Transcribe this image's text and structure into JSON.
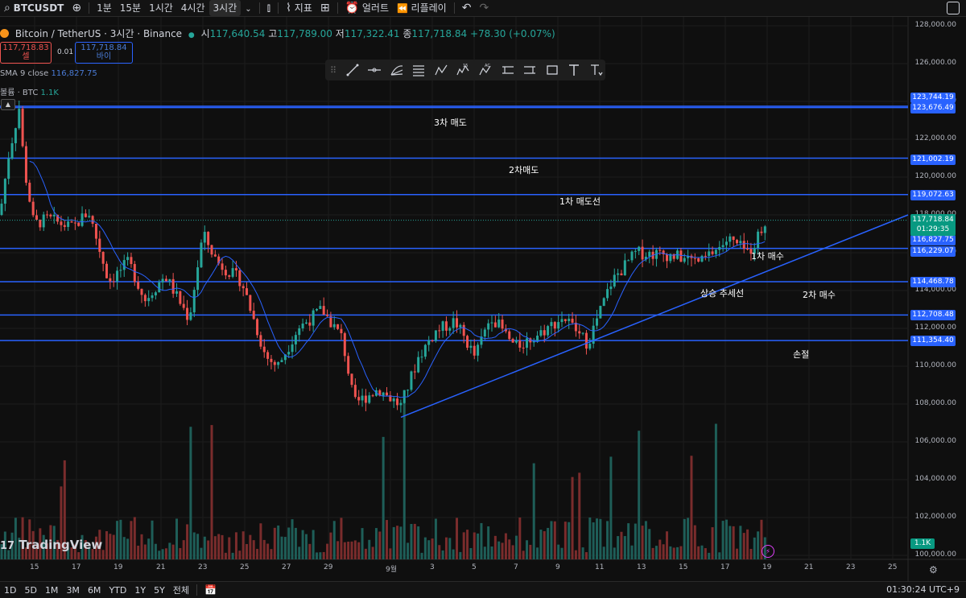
{
  "topbar": {
    "symbol": "BTCUSDT",
    "intervals": [
      "1분",
      "15분",
      "1시간",
      "4시간",
      "3시간"
    ],
    "active_interval": "3시간",
    "indicators_label": "지표",
    "alert_label": "얼러트",
    "replay_label": "리플레이"
  },
  "legend": {
    "title": "Bitcoin / TetherUS · 3시간 · Binance",
    "open_label": "시",
    "open": "117,640.54",
    "high_label": "고",
    "high": "117,789.00",
    "low_label": "저",
    "low": "117,322.41",
    "close_label": "종",
    "close": "117,718.84",
    "change": "+78.30 (+0.07%)",
    "sell_price": "117,718.83",
    "sell_label": "셀",
    "spread": "0.01",
    "buy_price": "117,718.84",
    "buy_label": "바이",
    "sma_label": "SMA 9 close",
    "sma_value": "116,827.75",
    "volume_label": "볼륨 · BTC",
    "volume_value": "1.1K"
  },
  "price_axis": {
    "ticks": [
      "128,000.00",
      "126,000.00",
      "124,000.00",
      "122,000.00",
      "120,000.00",
      "118,000.00",
      "116,000.00",
      "114,000.00",
      "112,000.00",
      "110,000.00",
      "108,000.00",
      "106,000.00",
      "104,000.00",
      "102,000.00",
      "100,000.00"
    ],
    "level_tags": [
      "123,744.19",
      "123,676.49",
      "121,002.19",
      "119,072.63",
      "116,827.75",
      "116,229.07",
      "114,468.78",
      "112,708.48",
      "111,354.40"
    ],
    "current_price": "117,718.84",
    "countdown": "01:29:35",
    "volume_tag": "1.1K"
  },
  "time_axis": {
    "labels": [
      "15",
      "17",
      "19",
      "21",
      "23",
      "25",
      "27",
      "29",
      "9월",
      "3",
      "5",
      "7",
      "9",
      "11",
      "13",
      "15",
      "17",
      "19",
      "21",
      "23",
      "25"
    ]
  },
  "annotations": {
    "sell3": "3차 매도",
    "sell2": "2차매도",
    "sell1": "1차 매도선",
    "buy1": "1차 매수",
    "trendline": "상승 추세선",
    "buy2": "2차 매수",
    "stop": "손절"
  },
  "bottombar": {
    "ranges": [
      "1D",
      "5D",
      "1M",
      "3M",
      "6M",
      "YTD",
      "1Y",
      "5Y",
      "전체"
    ],
    "clock": "01:30:24 UTC+9"
  },
  "branding": {
    "logo": "TradingView"
  },
  "colors": {
    "up": "#26a69a",
    "down": "#ef5350",
    "level": "#2962ff",
    "sma": "#2962ff",
    "background": "#0f0f0f"
  },
  "chart_data": {
    "type": "line",
    "ylim": [
      100000,
      128000
    ],
    "x": [
      "08-14",
      "08-16",
      "08-18",
      "08-20",
      "08-22",
      "08-24",
      "08-26",
      "08-28",
      "08-30",
      "09-01",
      "09-03",
      "09-05",
      "09-07",
      "09-09",
      "09-11",
      "09-13",
      "09-15",
      "09-17",
      "09-19"
    ],
    "series": [
      {
        "values": [
          121800,
          116200,
          117300,
          113400,
          115200,
          111800,
          112800,
          110800,
          108400,
          107900,
          111300,
          110900,
          110600,
          112200,
          114500,
          116200,
          115500,
          115800,
          117700
        ]
      }
    ],
    "horizontal_levels": [
      123744.19,
      123676.49,
      121002.19,
      119072.63,
      116229.07,
      114468.78,
      112708.48,
      111354.4
    ],
    "trendline_points": [
      [
        "08-31",
        107300
      ],
      [
        "09-19",
        118000
      ]
    ]
  }
}
